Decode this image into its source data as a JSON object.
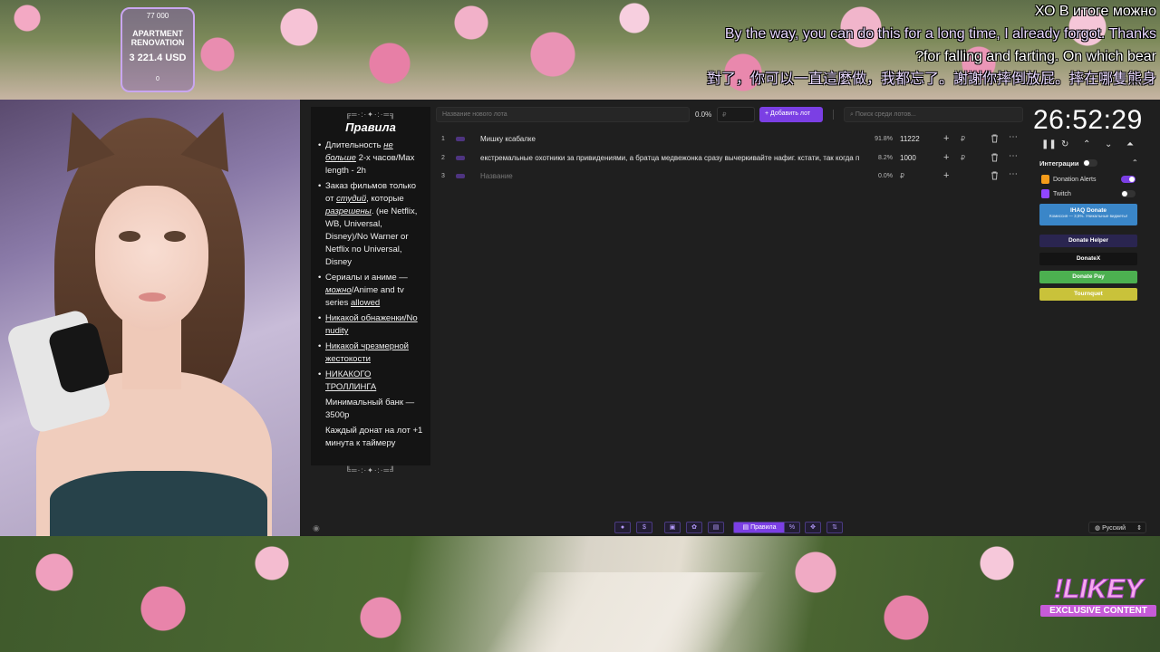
{
  "overlay": {
    "goal": {
      "top_value": "77 000",
      "name": "APARTMENT RENOVATION",
      "amount": "3 221.4 USD",
      "bottom_value": "0"
    },
    "subtitles": [
      "ХО В итоге можно",
      "By the way, you can do this for a long time, I already forgot. Thanks",
      "?for falling and farting. On which bear",
      "對了，你可以一直這麼做，我都忘了。謝謝你摔倒放屁。摔在哪隻熊身"
    ],
    "watermark": {
      "big": "!LIKEY",
      "small": "EXCLUSIVE CONTENT"
    }
  },
  "rules": {
    "deco_top": "╔═·:·✦·:·═╗",
    "title": "Правила",
    "deco_bottom": "╚═·:·✦·:·═╝",
    "items": {
      "i1_a": "Длительность ",
      "i1_b": "не больше",
      "i1_c": " 2-х часов/Max length - 2h",
      "i2_a": "Заказ фильмов только от ",
      "i2_b": "студий",
      "i2_c": ", которые ",
      "i2_d": "разрешены",
      "i2_e": ". (не Netflix, WB, Universal, Disney)/No Warner or Netflix no Universal, Disney",
      "i3_a": "Сериалы и аниме — ",
      "i3_b": "можно",
      "i3_c": "/Anime and tv series ",
      "i3_d": "allowed",
      "i4": "Никакой обнаженки/No nudity",
      "i5": "Никакой чрезмерной жестокости",
      "i6": "НИКАКОГО ТРОЛЛИНГА",
      "i7": "Минимальный банк — 3500р",
      "i8": "Каждый донат на лот +1 минута к таймеру"
    }
  },
  "toolbar": {
    "new_lot_placeholder": "Название нового лота",
    "percent": "0.0%",
    "amount_placeholder": "₽",
    "add_button": "Добавить лот",
    "search_placeholder": "Поиск среди лотов..."
  },
  "lots": [
    {
      "num": "1",
      "name": "Мишку ксабалке",
      "percent": "91.8%",
      "amount": "11222",
      "currency": "₽"
    },
    {
      "num": "2",
      "name": "екстремальные охотники за привидениями, а братца медвежонка сразу вычеркивайте нафиг. кстати, так когда п",
      "percent": "8.2%",
      "amount": "1000",
      "currency": "₽"
    },
    {
      "num": "3",
      "name": "Название",
      "percent": "0.0%",
      "amount": "",
      "currency": "₽"
    }
  ],
  "timer": {
    "time": "26:52:29"
  },
  "integrations": {
    "title": "Интеграции",
    "providers": [
      {
        "name": "Donation Alerts",
        "enabled": true,
        "color": "#f59c1a"
      },
      {
        "name": "Twitch",
        "enabled": false,
        "color": "#9146ff"
      }
    ],
    "services": [
      {
        "name": "IHAQ Donate",
        "sub": "Комиссия — 3,5%. Уникальные виджеты!",
        "color": "#3a86c8"
      },
      {
        "name": "Donate Helper",
        "color": "#2a2550"
      },
      {
        "name": "DonateX",
        "color": "#141414"
      },
      {
        "name": "Donate Pay",
        "color": "#4cb050"
      },
      {
        "name": "Tournquet",
        "color": "#c9c23a"
      }
    ]
  },
  "bottombar": {
    "rules_tab": "Правила",
    "language": "Русский"
  },
  "colors": {
    "accent": "#7b3fe4",
    "app_bg": "#1f1f1f",
    "panel_bg": "#141414"
  }
}
